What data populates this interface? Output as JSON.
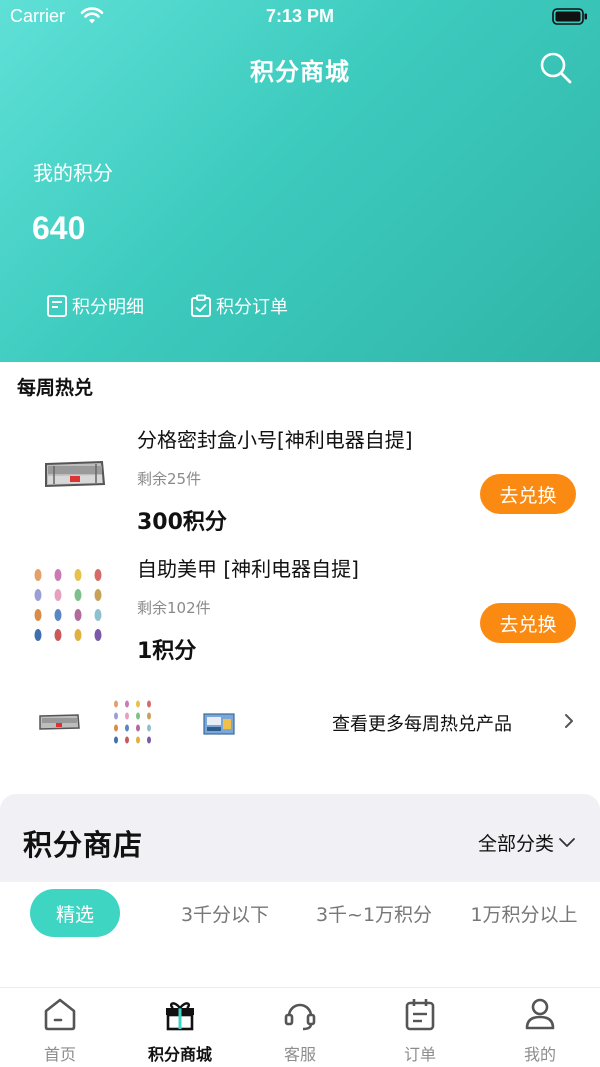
{
  "status_bar": {
    "carrier": "Carrier",
    "time": "7:13 PM"
  },
  "header": {
    "title": "积分商城",
    "points_label": "我的积分",
    "points_value": "640",
    "links": [
      {
        "label": "积分明细",
        "icon": "list-icon"
      },
      {
        "label": "积分订单",
        "icon": "clipboard-check-icon"
      }
    ]
  },
  "weekly": {
    "title": "每周热兑",
    "products": [
      {
        "name": "分格密封盒小号[神利电器自提]",
        "stock": "剩余25件",
        "price": "300积分",
        "button": "去兑换"
      },
      {
        "name": "自助美甲 [神利电器自提]",
        "stock": "剩余102件",
        "price": "1积分",
        "button": "去兑换"
      }
    ],
    "more_text": "查看更多每周热兑产品"
  },
  "shop": {
    "title": "积分商店",
    "category_label": "全部分类",
    "filters": [
      "精选",
      "3千分以下",
      "3千~1万积分",
      "1万积分以上"
    ],
    "active_filter": 0
  },
  "tabbar": {
    "items": [
      {
        "label": "首页",
        "icon": "home-icon"
      },
      {
        "label": "积分商城",
        "icon": "gift-icon"
      },
      {
        "label": "客服",
        "icon": "headset-icon"
      },
      {
        "label": "订单",
        "icon": "calendar-list-icon"
      },
      {
        "label": "我的",
        "icon": "user-icon"
      }
    ],
    "active": 1
  },
  "colors": {
    "header_start": "#5fe0d7",
    "header_end": "#2fb5a8",
    "accent_orange": "#fb8a12",
    "accent_teal": "#3fd5c3"
  }
}
